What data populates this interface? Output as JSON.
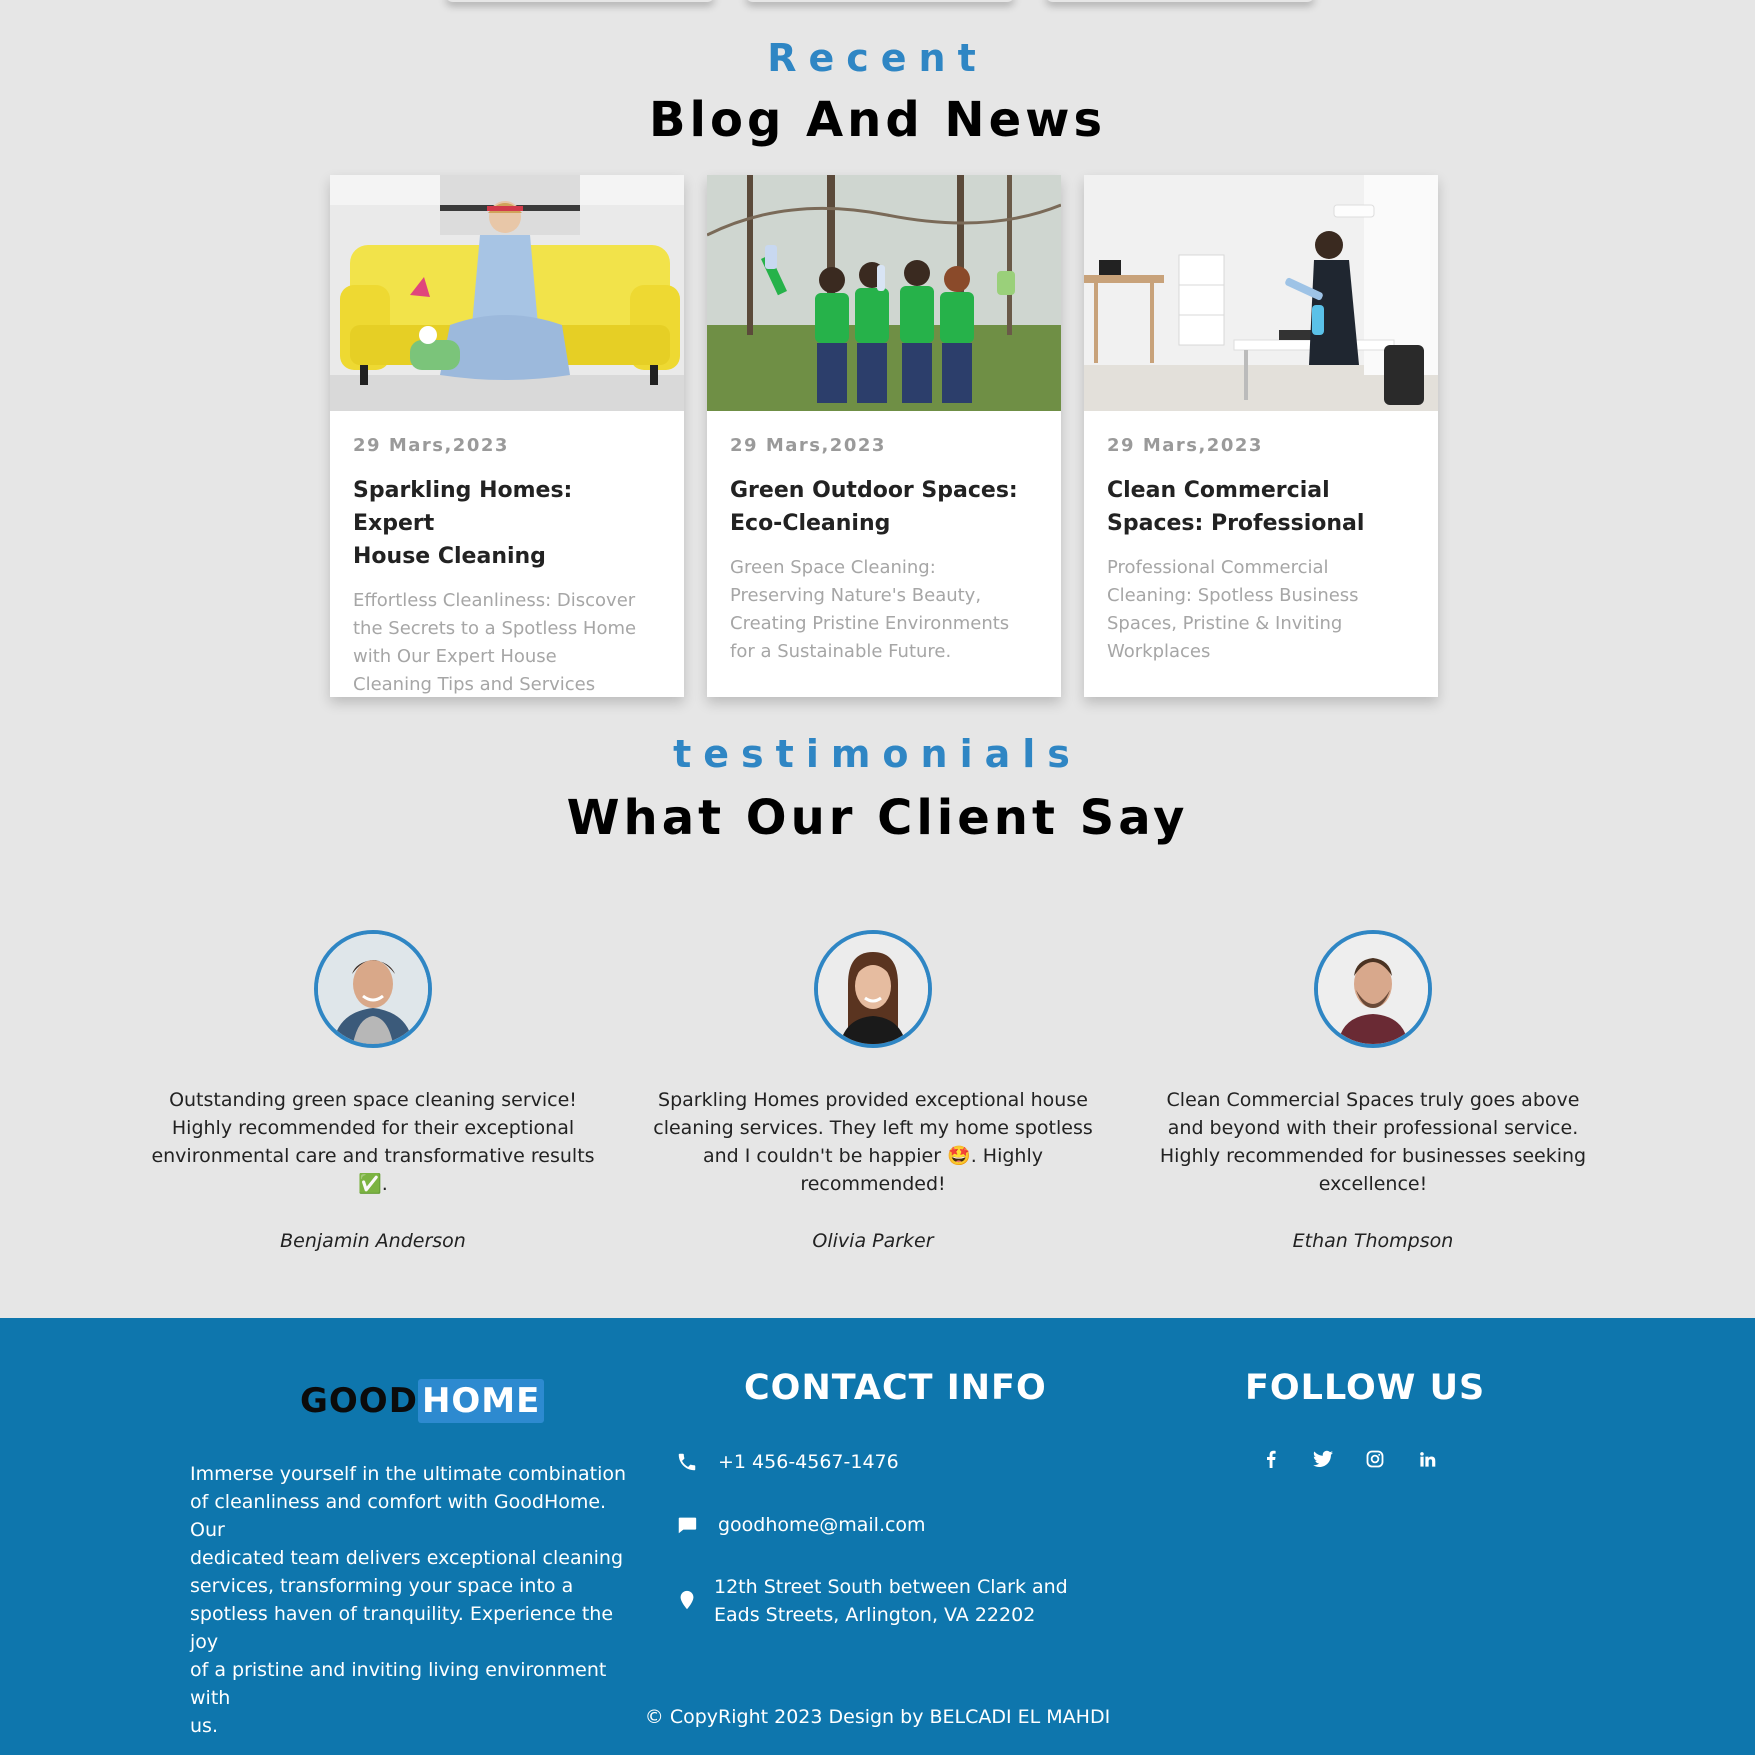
{
  "blog_section": {
    "kicker": "Recent",
    "title": "Blog And News",
    "posts": [
      {
        "date": "29 Mars,2023",
        "title_line1": "Sparkling Homes: Expert",
        "title_line2": "House Cleaning",
        "excerpt_lines": [
          "Effortless Cleanliness: Discover",
          "the Secrets to a Spotless Home",
          "with Our Expert House",
          "Cleaning Tips and Services"
        ]
      },
      {
        "date": "29 Mars,2023",
        "title_line1": "Green Outdoor Spaces:",
        "title_line2": "Eco-Cleaning",
        "excerpt_lines": [
          "Green Space Cleaning:",
          "Preserving Nature's Beauty,",
          "Creating Pristine Environments",
          "for a Sustainable Future."
        ]
      },
      {
        "date": "29 Mars,2023",
        "title_line1": "Clean Commercial",
        "title_line2": "Spaces: Professional",
        "excerpt_lines": [
          "Professional Commercial",
          "Cleaning: Spotless Business",
          "Spaces, Pristine & Inviting",
          "Workplaces"
        ]
      }
    ]
  },
  "testimonials_section": {
    "kicker": "testimonials",
    "title": "What Our Client Say",
    "items": [
      {
        "lines": [
          "Outstanding green space cleaning service!",
          "Highly recommended for their exceptional",
          "environmental care and transformative results",
          "✅."
        ],
        "name": "Benjamin Anderson"
      },
      {
        "lines": [
          "Sparkling Homes provided exceptional house",
          "cleaning services. They left my home spotless",
          "and I couldn't be happier 🤩. Highly",
          "recommended!"
        ],
        "name": "Olivia Parker"
      },
      {
        "lines": [
          "Clean Commercial Spaces truly goes above",
          "and beyond with their professional service.",
          "Highly recommended for businesses seeking",
          "excellence!"
        ],
        "name": "Ethan Thompson"
      }
    ]
  },
  "footer": {
    "logo_part1": "GOOD",
    "logo_part2": "HOME",
    "about_lines": [
      "Immerse yourself in the ultimate combination",
      "of cleanliness and comfort with GoodHome. Our",
      "dedicated team delivers exceptional cleaning",
      "services, transforming your space into a",
      "spotless haven of tranquility. Experience the joy",
      "of a pristine and inviting living environment with",
      "us."
    ],
    "contact_heading": "CONTACT INFO",
    "phone": "+1 456-4567-1476",
    "email": "goodhome@mail.com",
    "address_line1": "12th Street South between Clark and",
    "address_line2": "Eads Streets, Arlington, VA 22202",
    "follow_heading": "FOLLOW US",
    "social_icons": [
      "facebook-icon",
      "twitter-icon",
      "instagram-icon",
      "linkedin-icon"
    ],
    "copyright": "© CopyRight 2023 Design by BELCADI EL MAHDI"
  },
  "colors": {
    "background": "#e6e6e6",
    "accent": "#2f86c4",
    "footer": "#0e76ad"
  }
}
